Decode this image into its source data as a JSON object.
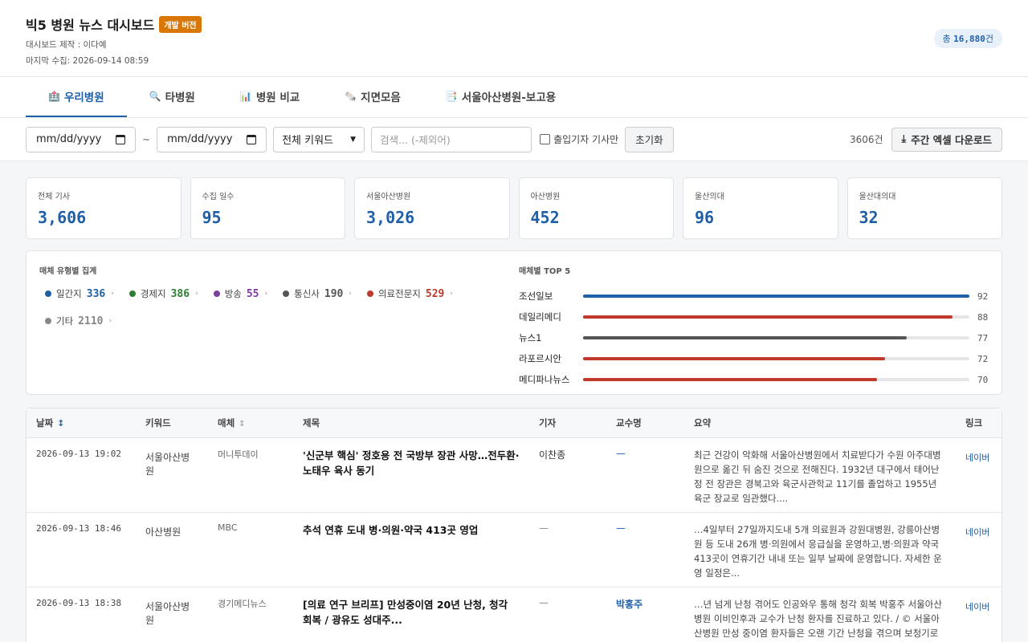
{
  "header": {
    "title": "빅5 병원 뉴스 대시보드",
    "badge": "개발 버전",
    "author": "대시보드 제작 : 이다예",
    "last_collected": "마지막 수집: 2026-09-14 08:59",
    "total_prefix": "총",
    "total_value": "16,880",
    "total_suffix": "건"
  },
  "tabs": [
    {
      "icon": "🏥",
      "label": "우리병원",
      "active": true
    },
    {
      "icon": "🔍",
      "label": "타병원"
    },
    {
      "icon": "📊",
      "label": "병원 비교"
    },
    {
      "icon": "🗞️",
      "label": "지면모음"
    },
    {
      "icon": "📑",
      "label": "서울아산병원-보고용"
    }
  ],
  "filters": {
    "date_from": "mm/dd/yyyy",
    "tilde": "~",
    "date_to": "mm/dd/yyyy",
    "keyword_select": "전체 키워드",
    "search_placeholder": "검색... (-제외어)",
    "reporter_only": "출입기자 기사만",
    "reset": "초기화",
    "count": "3606건",
    "download": "주간 엑셀 다운로드"
  },
  "stats": [
    {
      "label": "전체 기사",
      "value": "3,606"
    },
    {
      "label": "수집 일수",
      "value": "95"
    },
    {
      "label": "서울아산병원",
      "value": "3,026"
    },
    {
      "label": "아산병원",
      "value": "452"
    },
    {
      "label": "울산의대",
      "value": "96"
    },
    {
      "label": "울산대의대",
      "value": "32"
    }
  ],
  "media_types": {
    "heading": "매체 유형별 집계",
    "items": [
      {
        "label": "일간지",
        "value": "336",
        "color": "#1f5fa8"
      },
      {
        "label": "경제지",
        "value": "386",
        "color": "#2e7d32"
      },
      {
        "label": "방송",
        "value": "55",
        "color": "#7b3fa0"
      },
      {
        "label": "통신사",
        "value": "190",
        "color": "#555555"
      },
      {
        "label": "의료전문지",
        "value": "529",
        "color": "#c0392b"
      },
      {
        "label": "기타",
        "value": "2110",
        "color": "#888888"
      }
    ]
  },
  "top5": {
    "heading": "매체별 TOP 5",
    "max": 92,
    "items": [
      {
        "name": "조선일보",
        "value": 92,
        "color": "#1f5fa8"
      },
      {
        "name": "데일리메디",
        "value": 88,
        "color": "#c0392b"
      },
      {
        "name": "뉴스1",
        "value": 77,
        "color": "#555555"
      },
      {
        "name": "라포르시안",
        "value": 72,
        "color": "#c0392b"
      },
      {
        "name": "메디파나뉴스",
        "value": 70,
        "color": "#c0392b"
      }
    ]
  },
  "table": {
    "columns": {
      "date": "날짜",
      "keyword": "키워드",
      "media": "매체",
      "title": "제목",
      "reporter": "기자",
      "professor": "교수명",
      "summary": "요약",
      "link": "링크"
    },
    "rows": [
      {
        "date": "2026-09-13 19:02",
        "keyword": "서울아산병원",
        "media": "머니투데이",
        "title": "'신군부 핵심' 정호용 전 국방부 장관 사망…전두환·노태우 육사 동기",
        "reporter": "이찬종",
        "professor": "—",
        "summary": "최근 건강이 악화해 서울아산병원에서 치료받다가 수원 아주대병원으로 옮긴 뒤 숨진 것으로 전해진다. 1932년 대구에서 태어난 정 전 장관은 경북고와 육군사관학교 11기를 졸업하고 1955년 육군 장교로 임관했다....",
        "link": "네이버"
      },
      {
        "date": "2026-09-13 18:46",
        "keyword": "아산병원",
        "media": "MBC",
        "title": "추석 연휴 도내 병·의원·약국 413곳 영업",
        "reporter": "—",
        "professor": "—",
        "summary": "…4일부터 27일까지도내 5개 의료원과 강원대병원, 강릉아산병원 등 도내 26개 병·의원에서 응급실을 운영하고,병·의원과 약국 413곳이 연휴기간 내내 또는 일부 날짜에 운영합니다. 자세한 운영 일정은...",
        "link": "네이버"
      },
      {
        "date": "2026-09-13 18:38",
        "keyword": "서울아산병원",
        "media": "경기메디뉴스",
        "title": "[의료 연구 브리프] 만성중이염 20년 난청, 청각 회복 / 광유도 성대주...",
        "reporter": "—",
        "professor": "박홍주",
        "summary": "…년 넘게 난청 겪어도 인공와우 통해 청각 회복 박홍주 서울아산병원 이비인후과 교수가 난청 환자를 진료하고 있다. / © 서울아산병원 만성 중이염 환자들은 오랜 기간 난청을 겪으며 보청기로",
        "link": "네이버"
      }
    ]
  }
}
